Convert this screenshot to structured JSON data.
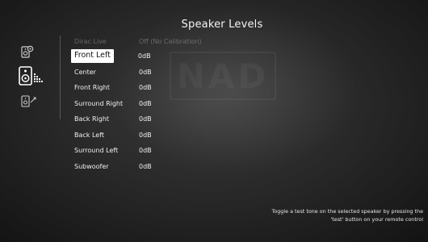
{
  "header": {
    "title": "Speaker Levels"
  },
  "watermark": {
    "text": "NAD"
  },
  "rail": {
    "items": [
      {
        "icon": "speaker-config-icon"
      },
      {
        "icon": "speaker-levels-icon",
        "active": true
      },
      {
        "icon": "speaker-distance-icon"
      }
    ]
  },
  "list": {
    "dirac": {
      "label": "Dirac Live",
      "value": "Off (No Calibration)"
    },
    "rows": [
      {
        "label": "Front Left",
        "value": "0dB"
      },
      {
        "label": "Center",
        "value": "0dB"
      },
      {
        "label": "Front Right",
        "value": "0dB"
      },
      {
        "label": "Surround Right",
        "value": "0dB"
      },
      {
        "label": "Back Right",
        "value": "0dB"
      },
      {
        "label": "Back Left",
        "value": "0dB"
      },
      {
        "label": "Surround Left",
        "value": "0dB"
      },
      {
        "label": "Subwoofer",
        "value": "0dB"
      }
    ],
    "selected_index": 0
  },
  "hint": {
    "line1": "Toggle a test tone on the selected speaker by pressing the",
    "line2": "'test' button on your remote control"
  }
}
